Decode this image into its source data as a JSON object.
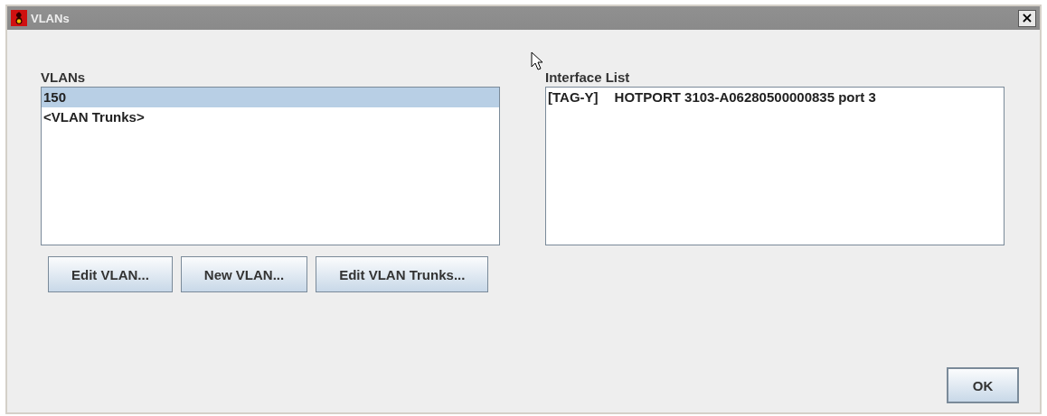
{
  "window": {
    "title": "VLANs",
    "close": "×"
  },
  "vlans": {
    "label": "VLANs",
    "items": [
      {
        "text": "150",
        "selected": true
      },
      {
        "text": "<VLAN Trunks>",
        "selected": false
      }
    ]
  },
  "interface_list": {
    "label": "Interface List",
    "items": [
      {
        "tag": "[TAG-Y]",
        "text": "HOTPORT 3103-A06280500000835 port 3"
      }
    ]
  },
  "buttons": [
    "Edit VLAN...",
    "New VLAN...",
    "Edit VLAN Trunks..."
  ],
  "ok_button": "OK"
}
